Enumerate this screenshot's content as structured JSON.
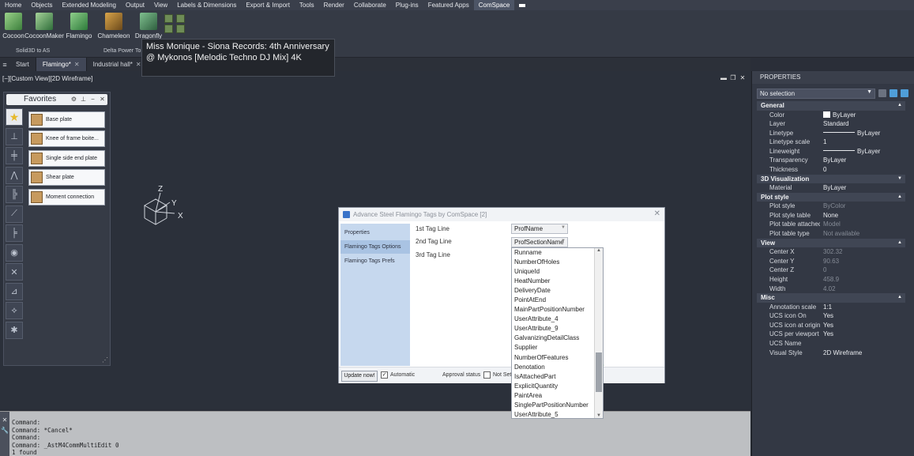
{
  "menubar": {
    "items": [
      "Home",
      "Objects",
      "Extended Modeling",
      "Output",
      "View",
      "Labels & Dimensions",
      "Export & Import",
      "Tools",
      "Render",
      "Collaborate",
      "Plug-ins",
      "Featured Apps",
      "ComSpace"
    ],
    "active": "ComSpace"
  },
  "ribbon": {
    "buttons": [
      {
        "label": "Cocoon"
      },
      {
        "label": "CocoonMaker"
      },
      {
        "label": "Flamingo"
      },
      {
        "label": "Chameleon"
      },
      {
        "label": "Dragonfly"
      }
    ],
    "group_labels": [
      "Solid3D to AS",
      "Delta Power To"
    ]
  },
  "tooltip": {
    "text": "Miss Monique -  Siona Records: 4th Anniversary @ Mykonos [Melodic Techno DJ Mix] 4K"
  },
  "filetabs": {
    "tabs": [
      {
        "label": "Start"
      },
      {
        "label": "Flamingo*"
      },
      {
        "label": "Industrial hall*"
      }
    ],
    "plus": "+"
  },
  "viewport": {
    "label": "[−][Custom View][2D Wireframe]"
  },
  "favorites": {
    "title": "Favorites",
    "items": [
      "Base plate",
      "Knee of frame boite...",
      "Single side end plate",
      "Shear plate",
      "Moment connection"
    ]
  },
  "ucs": {
    "x": "X",
    "y": "Y",
    "z": "Z"
  },
  "properties": {
    "title": "PROPERTIES",
    "selection": "No selection",
    "sections": [
      {
        "name": "General",
        "rows": [
          {
            "k": "Color",
            "v": "ByLayer"
          },
          {
            "k": "Layer",
            "v": "Standard"
          },
          {
            "k": "Linetype",
            "v": "ByLayer"
          },
          {
            "k": "Linetype scale",
            "v": "1"
          },
          {
            "k": "Lineweight",
            "v": "ByLayer"
          },
          {
            "k": "Transparency",
            "v": "ByLayer"
          },
          {
            "k": "Thickness",
            "v": "0"
          }
        ]
      },
      {
        "name": "3D Visualization",
        "rows": [
          {
            "k": "Material",
            "v": "ByLayer"
          }
        ]
      },
      {
        "name": "Plot style",
        "rows": [
          {
            "k": "Plot style",
            "v": "ByColor"
          },
          {
            "k": "Plot style table",
            "v": "None"
          },
          {
            "k": "Plot table attached to",
            "v": "Model"
          },
          {
            "k": "Plot table type",
            "v": "Not available"
          }
        ]
      },
      {
        "name": "View",
        "rows": [
          {
            "k": "Center X",
            "v": "302.32"
          },
          {
            "k": "Center Y",
            "v": "90.63"
          },
          {
            "k": "Center Z",
            "v": "0"
          },
          {
            "k": "Height",
            "v": "458.9"
          },
          {
            "k": "Width",
            "v": "4.02"
          }
        ]
      },
      {
        "name": "Misc",
        "rows": [
          {
            "k": "Annotation scale",
            "v": "1:1"
          },
          {
            "k": "UCS icon On",
            "v": "Yes"
          },
          {
            "k": "UCS icon at origin",
            "v": "Yes"
          },
          {
            "k": "UCS per viewport",
            "v": "Yes"
          },
          {
            "k": "UCS Name",
            "v": ""
          },
          {
            "k": "Visual Style",
            "v": "2D Wireframe"
          }
        ]
      }
    ]
  },
  "dialog": {
    "title": "Advance Steel   Flamingo Tags by ComSpace [2]",
    "nav": [
      "Properties",
      "Flamingo Tags Options",
      "Flamingo Tags Prefs"
    ],
    "selected_nav": "Flamingo Tags Options",
    "tag_lines": [
      {
        "label": "1st Tag Line",
        "value": "ProfName"
      },
      {
        "label": "2nd Tag Line",
        "value": "ProfSectionName"
      },
      {
        "label": "3rd Tag Line",
        "value": ""
      }
    ],
    "dropdown_options": [
      "Runname",
      "NumberOfHoles",
      "UniqueId",
      "HeatNumber",
      "DeliveryDate",
      "PointAtEnd",
      "MainPartPositionNumber",
      "UserAttribute_4",
      "UserAttribute_9",
      "GalvanizingDetailClass",
      "Supplier",
      "NumberOfFeatures",
      "Denotation",
      "IsAttachedPart",
      "ExplicitQuantity",
      "PaintArea",
      "SinglePartPositionNumber",
      "UserAttribute_5"
    ],
    "footer": {
      "update": "Update now!",
      "automatic": "Automatic",
      "approval": "Approval status",
      "status": "Not Set"
    }
  },
  "command": {
    "lines": [
      "Command:",
      "Command: *Cancel*",
      "Command:",
      "Command: _AstM4CommMultiEdit 0",
      "1 found"
    ]
  }
}
